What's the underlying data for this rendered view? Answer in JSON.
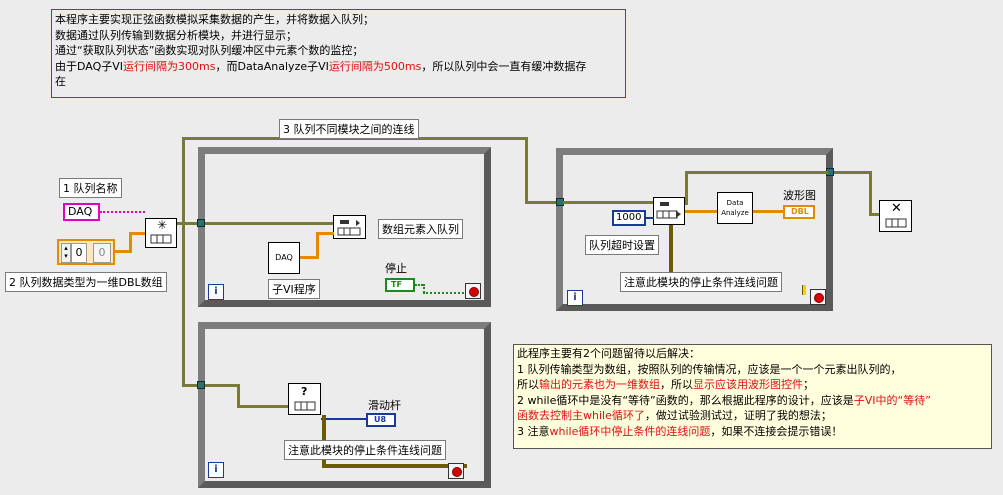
{
  "top_note": {
    "lines": [
      "本程序主要实现正弦函数模拟采集数据的产生，并将数据入队列；",
      "数据通过队列传输到数据分析模块，并进行显示；",
      "通过“获取队列状态”函数实现对队列缓冲区中元素个数的监控；"
    ],
    "line4_a": "由于DAQ子VI",
    "line4_b": "运行间隔为300ms",
    "line4_c": "，而DataAnalyze子VI",
    "line4_d": "运行间隔为500ms",
    "line4_e": "，所以队列中会一直有缓冲数据存",
    "line5": "在"
  },
  "labels": {
    "queue_name": "1 队列名称",
    "queue_type": "2 队列数据类型为一维DBL数组",
    "wire_between": "3 队列不同模块之间的连线",
    "enqueue": "数组元素入队列",
    "subvi": "子VI程序",
    "stop": "停止",
    "slider": "滑动杆",
    "stop_wire_left": "注意此模块的停止条件连线问题",
    "timeout": "队列超时设置",
    "stop_wire_right": "注意此模块的停止条件连线问题",
    "waveform": "波形图"
  },
  "consts": {
    "daq_string": "DAQ",
    "zero_a": "0",
    "zero_b": "0",
    "timeout_value": "1000",
    "tf": "TF",
    "u8": "U8",
    "dbl": "DBL",
    "daq_subvi": "DAQ",
    "analyze_line1": "Data",
    "analyze_line2": "Analyze",
    "iter_symbol": "i"
  },
  "bottom_note": {
    "title": "此程序主要有2个问题留待以后解决：",
    "p1a": "1 队列传输类型为数组，按照队列的传输情况，应该是一个一个元素出队列的，",
    "p1b_pre": "所以",
    "p1b_red1": "输出的元素也为一维数组",
    "p1b_mid": "，所以",
    "p1b_red2": "显示应该用波形图控件",
    "p1b_end": "；",
    "p2a_pre": "2 while循环中是没有“等待”函数的，那么根据此程序的设计，应该是",
    "p2a_red": "子VI中的“等待”",
    "p2b_red": "函数去控制主while循环了",
    "p2b_end": "，做过试验测试过，证明了我的想法；",
    "p3_pre": "3 注意",
    "p3_red": "while循环中停止条件的连线问题",
    "p3_end": "，如果不连接会提示错误！"
  },
  "colors": {
    "note_border": "#d21a1a",
    "red_text": "#e01010",
    "bottom_note_bg": "#ffffdd",
    "string_pink": "#e000c0",
    "numeric_orange": "#e28a00",
    "queue_wire": "#7a7a38",
    "bool_green": "#1c8a1c",
    "numeric_blue": "#1a3a9a"
  }
}
